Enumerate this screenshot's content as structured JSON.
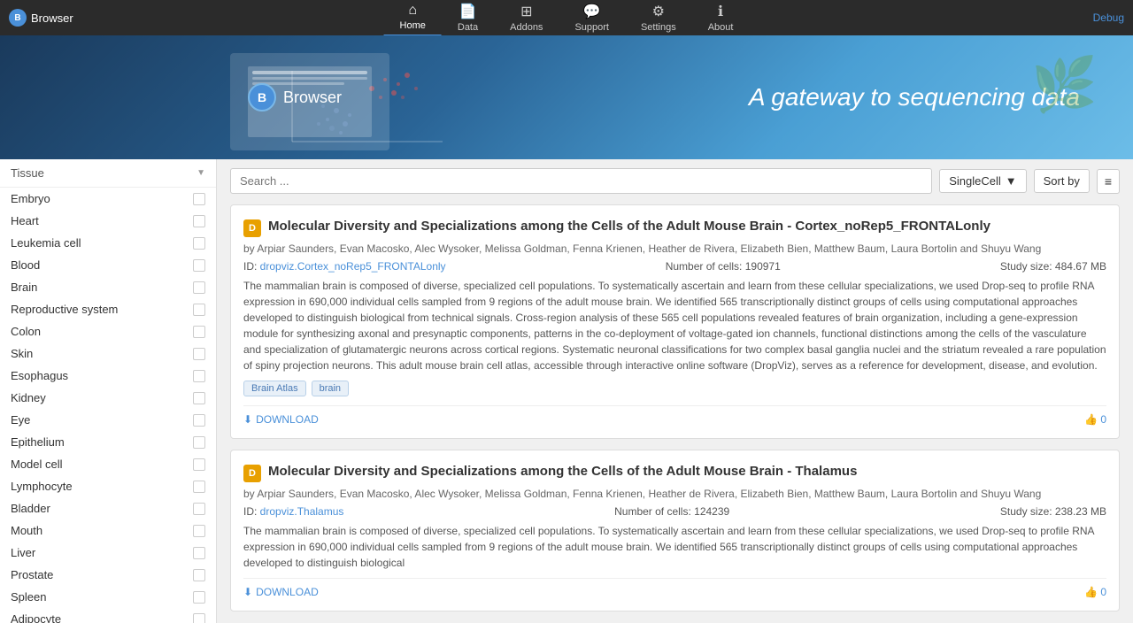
{
  "app": {
    "title": "Browser",
    "debug_label": "Debug"
  },
  "nav": {
    "items": [
      {
        "id": "home",
        "label": "Home",
        "icon": "⌂",
        "active": true
      },
      {
        "id": "data",
        "label": "Data",
        "icon": "📄"
      },
      {
        "id": "addons",
        "label": "Addons",
        "icon": "⊞"
      },
      {
        "id": "support",
        "label": "Support",
        "icon": "💬"
      },
      {
        "id": "settings",
        "label": "Settings",
        "icon": "⚙"
      },
      {
        "id": "about",
        "label": "About",
        "icon": "ℹ"
      }
    ]
  },
  "hero": {
    "tagline": "A gateway to sequencing data",
    "logo_text": "Browser"
  },
  "sidebar": {
    "header": "Tissue",
    "items": [
      {
        "label": "Embryo",
        "checked": false
      },
      {
        "label": "Heart",
        "checked": false
      },
      {
        "label": "Leukemia cell",
        "checked": false
      },
      {
        "label": "Blood",
        "checked": false
      },
      {
        "label": "Brain",
        "checked": false
      },
      {
        "label": "Reproductive system",
        "checked": false
      },
      {
        "label": "Colon",
        "checked": false
      },
      {
        "label": "Skin",
        "checked": false
      },
      {
        "label": "Esophagus",
        "checked": false
      },
      {
        "label": "Kidney",
        "checked": false
      },
      {
        "label": "Eye",
        "checked": false
      },
      {
        "label": "Epithelium",
        "checked": false
      },
      {
        "label": "Model cell",
        "checked": false
      },
      {
        "label": "Lymphocyte",
        "checked": false
      },
      {
        "label": "Bladder",
        "checked": false
      },
      {
        "label": "Mouth",
        "checked": false
      },
      {
        "label": "Liver",
        "checked": false
      },
      {
        "label": "Prostate",
        "checked": false
      },
      {
        "label": "Spleen",
        "checked": false
      },
      {
        "label": "Adipocyte",
        "checked": false
      }
    ]
  },
  "search": {
    "placeholder": "Search ...",
    "filter_value": "SingleCell",
    "sort_label": "Sort by"
  },
  "datasets": [
    {
      "id": "dataset-1",
      "icon_label": "D",
      "title": "Molecular Diversity and Specializations among the Cells of the Adult Mouse Brain - Cortex_noRep5_FRONTALonly",
      "authors": "by Arpiar Saunders, Evan Macosko, Alec Wysoker, Melissa Goldman, Fenna Krienen, Heather de Rivera, Elizabeth Bien, Matthew Baum, Laura Bortolin and Shuyu Wang",
      "id_label": "ID: dropviz.Cortex_noRep5_FRONTALonly",
      "id_url": "dropviz.Cortex_noRep5_FRONTALonly",
      "cell_count_label": "Number of cells: 190971",
      "study_size_label": "Study size: 484.67 MB",
      "description": "The mammalian brain is composed of diverse, specialized cell populations. To systematically ascertain and learn from these cellular specializations, we used Drop-seq to profile RNA expression in 690,000 individual cells sampled from 9 regions of the adult mouse brain. We identified 565 transcriptionally distinct groups of cells using computational approaches developed to distinguish biological from technical signals. Cross-region analysis of these 565 cell populations revealed features of brain organization, including a gene-expression module for synthesizing axonal and presynaptic components, patterns in the co-deployment of voltage-gated ion channels, functional distinctions among the cells of the vasculature and specialization of glutamatergic neurons across cortical regions. Systematic neuronal classifications for two complex basal ganglia nuclei and the striatum revealed a rare population of spiny projection neurons. This adult mouse brain cell atlas, accessible through interactive online software (DropViz), serves as a reference for development, disease, and evolution.",
      "tags": [
        "Brain Atlas",
        "brain"
      ],
      "download_label": "DOWNLOAD",
      "likes": "0"
    },
    {
      "id": "dataset-2",
      "icon_label": "D",
      "title": "Molecular Diversity and Specializations among the Cells of the Adult Mouse Brain - Thalamus",
      "authors": "by Arpiar Saunders, Evan Macosko, Alec Wysoker, Melissa Goldman, Fenna Krienen, Heather de Rivera, Elizabeth Bien, Matthew Baum, Laura Bortolin and Shuyu Wang",
      "id_label": "ID: dropviz.Thalamus",
      "id_url": "dropviz.Thalamus",
      "cell_count_label": "Number of cells: 124239",
      "study_size_label": "Study size: 238.23 MB",
      "description": "The mammalian brain is composed of diverse, specialized cell populations. To systematically ascertain and learn from these cellular specializations, we used Drop-seq to profile RNA expression in 690,000 individual cells sampled from 9 regions of the adult mouse brain. We identified 565 transcriptionally distinct groups of cells using computational approaches developed to distinguish biological",
      "tags": [],
      "download_label": "DOWNLOAD",
      "likes": "0"
    }
  ]
}
